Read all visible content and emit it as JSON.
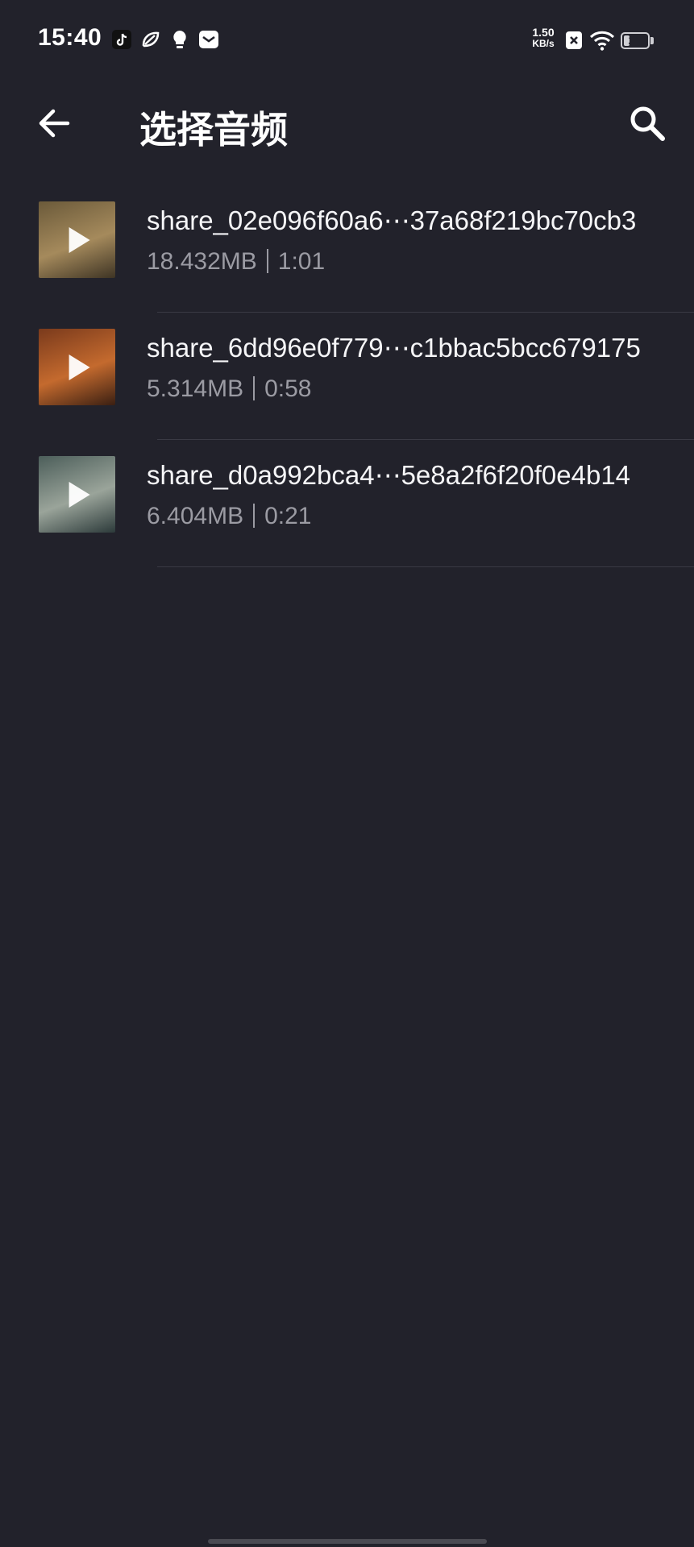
{
  "status_bar": {
    "time": "15:40",
    "net_speed_value": "1.50",
    "net_speed_unit": "KB/s",
    "battery": "21",
    "battery_level_percent": 21,
    "icons": [
      "tiktok-icon",
      "leaf-app-icon",
      "lightbulb-icon",
      "message-app-icon",
      "sim-x-icon",
      "wifi-icon"
    ]
  },
  "app_bar": {
    "title": "选择音频",
    "back_icon": "arrow-left-icon",
    "search_icon": "search-icon"
  },
  "files": [
    {
      "name": "share_02e096f60a6⋯37a68f219bc70cb3",
      "size": "18.432MB",
      "duration": "1:01",
      "thumb_colors": [
        "#6b5a3a",
        "#a58a5c",
        "#3e3424"
      ]
    },
    {
      "name": "share_6dd96e0f779⋯c1bbac5bcc679175",
      "size": "5.314MB",
      "duration": "0:58",
      "thumb_colors": [
        "#7a3a1c",
        "#c46a2e",
        "#3a1f12"
      ]
    },
    {
      "name": "share_d0a992bca4⋯5e8a2f6f20f0e4b14",
      "size": "6.404MB",
      "duration": "0:21",
      "thumb_colors": [
        "#4c5e5a",
        "#9aa49a",
        "#2c3a3a"
      ]
    }
  ]
}
